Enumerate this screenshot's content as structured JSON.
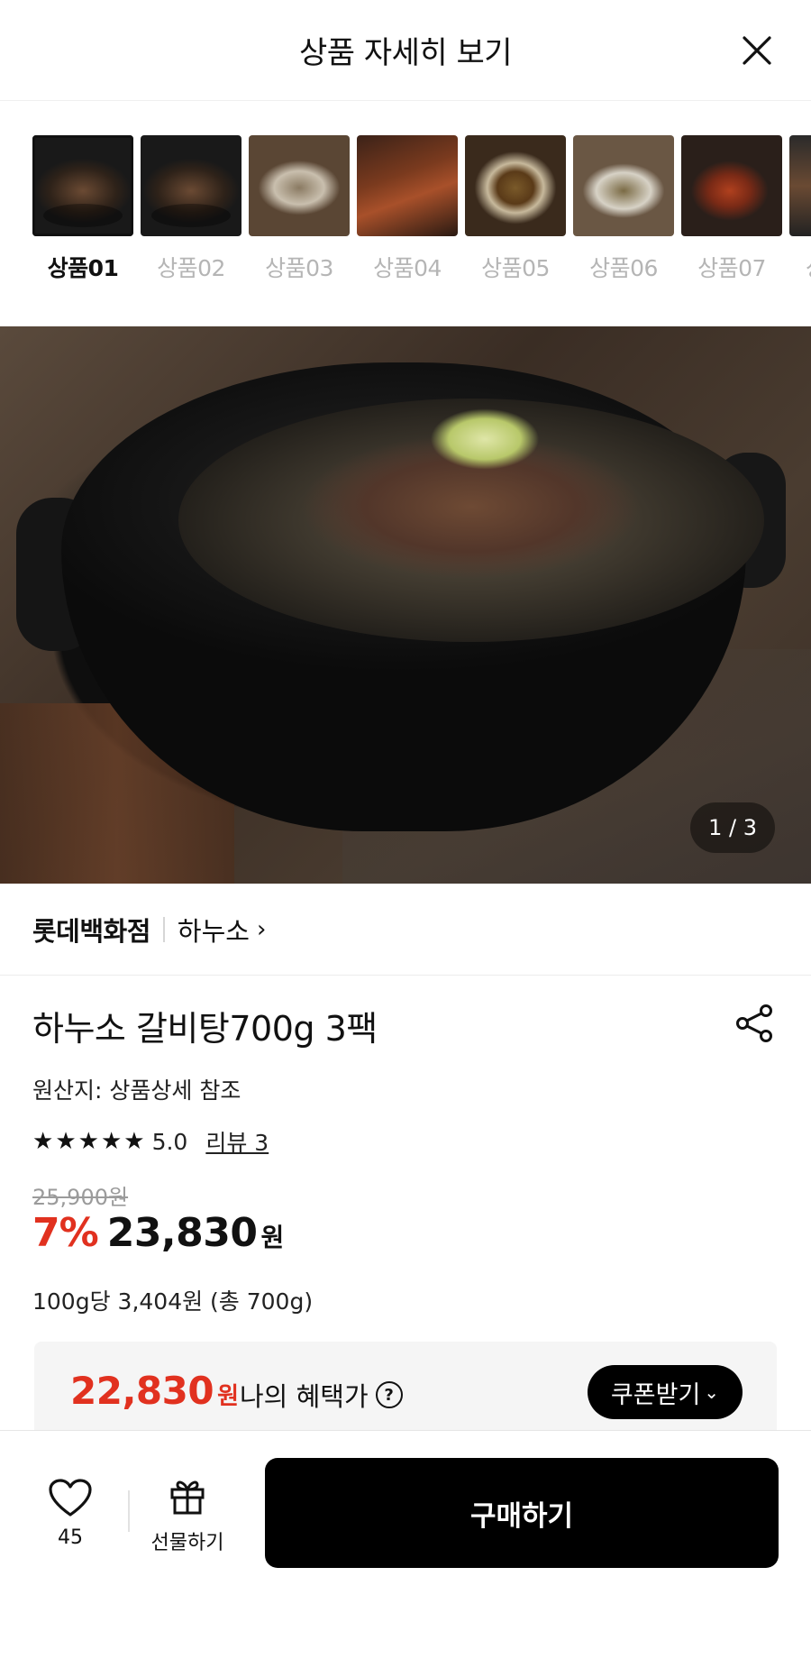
{
  "header": {
    "title": "상품 자세히 보기",
    "close_icon": "close-icon"
  },
  "thumbnails": [
    {
      "label": "상품01",
      "active": true
    },
    {
      "label": "상품02",
      "active": false
    },
    {
      "label": "상품03",
      "active": false
    },
    {
      "label": "상품04",
      "active": false
    },
    {
      "label": "상품05",
      "active": false
    },
    {
      "label": "상품06",
      "active": false
    },
    {
      "label": "상품07",
      "active": false
    },
    {
      "label": "상",
      "active": false
    }
  ],
  "hero": {
    "page_indicator": "1 / 3"
  },
  "store": {
    "name": "롯데백화점",
    "brand": "하누소",
    "brand_chevron": "›"
  },
  "product": {
    "title": "하누소 갈비탕700g 3팩",
    "origin": "원산지: 상품상세 참조",
    "rating": "5.0",
    "stars": 5,
    "review_link": "리뷰 3",
    "original_price": "25,900원",
    "discount": "7%",
    "price": "23,830",
    "price_unit": "원",
    "unit_price": "100g당 3,404원 (총 700g)"
  },
  "benefit": {
    "amount": "22,830",
    "unit": "원",
    "label": "나의 혜택가",
    "help": "?",
    "coupon_button": "쿠폰받기",
    "coupon_chevron": "⌄"
  },
  "bottom_bar": {
    "like_count": "45",
    "gift_label": "선물하기",
    "buy_label": "구매하기"
  },
  "colors": {
    "accent_red": "#e1311f",
    "black": "#000000",
    "muted": "#b5b5b5"
  }
}
